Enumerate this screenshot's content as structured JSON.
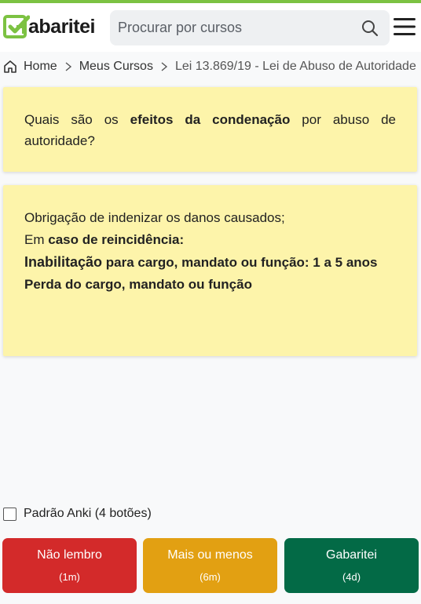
{
  "header": {
    "logo_text": "abaritei",
    "search_placeholder": "Procurar por cursos",
    "accent_color": "#7cc242"
  },
  "breadcrumb": {
    "home": "Home",
    "course": "Meus Cursos",
    "current": "Lei 13.869/19 - Lei de Abuso de Autoridade"
  },
  "question": {
    "part1": "Quais são os ",
    "bold": "efeitos da condenação",
    "part2": " por abuso de autoridade?"
  },
  "answer": {
    "line1": "Obrigação de indenizar os danos causados;",
    "line2_prefix": "Em ",
    "line2_bold": "caso de reincidência:",
    "line3_bold_lead": "Inabilitação",
    "line3_rest": " para cargo, mandato ou função: 1 a 5 anos",
    "line4": "Perda do cargo, mandato ou função"
  },
  "anki_option": {
    "label": "Padrão Anki (4 botões)",
    "checked": false
  },
  "buttons": [
    {
      "label": "Não lembro",
      "interval": "(1m)",
      "color": "#d32a2a"
    },
    {
      "label": "Mais ou menos",
      "interval": "(6m)",
      "color": "#e2a012"
    },
    {
      "label": "Gabaritei",
      "interval": "(4d)",
      "color": "#036a46"
    }
  ]
}
